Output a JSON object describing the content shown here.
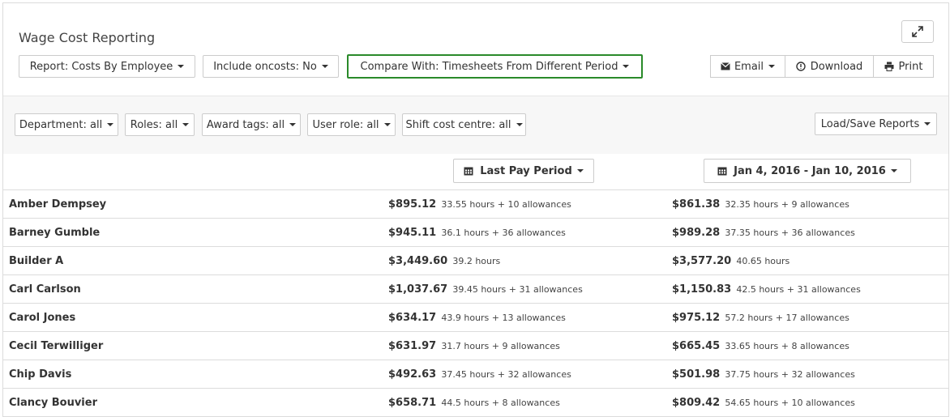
{
  "title": "Wage Cost Reporting",
  "toolbar": {
    "report_label": "Report: Costs By Employee",
    "oncosts_label": "Include oncosts: No",
    "compare_label": "Compare With: Timesheets From Different Period",
    "email_label": "Email",
    "download_label": "Download",
    "print_label": "Print",
    "expand_icon": "expand-icon"
  },
  "filters": {
    "department": "Department: all",
    "roles": "Roles: all",
    "award_tags": "Award tags: all",
    "user_role": "User role: all",
    "shift_cost_centre": "Shift cost centre: all",
    "load_save": "Load/Save Reports"
  },
  "periods": {
    "left": "Last Pay Period",
    "right": "Jan 4, 2016 - Jan 10, 2016"
  },
  "rows": [
    {
      "name": "Amber Dempsey",
      "a1": "$895.12",
      "d1": "33.55 hours + 10 allowances",
      "a2": "$861.38",
      "d2": "32.35 hours + 9 allowances"
    },
    {
      "name": "Barney Gumble",
      "a1": "$945.11",
      "d1": "36.1 hours + 36 allowances",
      "a2": "$989.28",
      "d2": "37.35 hours + 36 allowances"
    },
    {
      "name": "Builder A",
      "a1": "$3,449.60",
      "d1": "39.2 hours",
      "a2": "$3,577.20",
      "d2": "40.65 hours"
    },
    {
      "name": "Carl Carlson",
      "a1": "$1,037.67",
      "d1": "39.45 hours + 31 allowances",
      "a2": "$1,150.83",
      "d2": "42.5 hours + 31 allowances"
    },
    {
      "name": "Carol Jones",
      "a1": "$634.17",
      "d1": "43.9 hours + 13 allowances",
      "a2": "$975.12",
      "d2": "57.2 hours + 17 allowances"
    },
    {
      "name": "Cecil Terwilliger",
      "a1": "$631.97",
      "d1": "31.7 hours + 9 allowances",
      "a2": "$665.45",
      "d2": "33.65 hours + 8 allowances"
    },
    {
      "name": "Chip Davis",
      "a1": "$492.63",
      "d1": "37.45 hours + 32 allowances",
      "a2": "$501.98",
      "d2": "37.75 hours + 32 allowances"
    },
    {
      "name": "Clancy Bouvier",
      "a1": "$658.71",
      "d1": "44.5 hours + 8 allowances",
      "a2": "$809.42",
      "d2": "54.65 hours + 10 allowances"
    }
  ],
  "colors": {
    "accent_green": "#2a8a2a",
    "border": "#cccccc",
    "filter_bg": "#f7f7f7"
  }
}
